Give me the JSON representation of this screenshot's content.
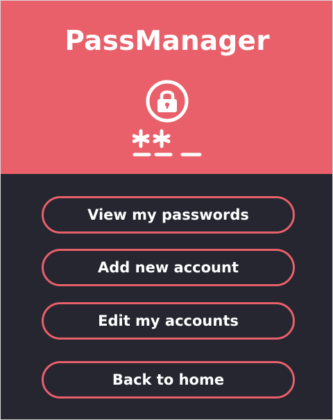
{
  "app": {
    "title": "PassManager",
    "logo_icon": "padlock-password-icon"
  },
  "menu": {
    "buttons": [
      {
        "label": "View my passwords"
      },
      {
        "label": "Add new account"
      },
      {
        "label": "Edit my accounts"
      },
      {
        "label": "Back to home"
      }
    ]
  },
  "colors": {
    "accent": "#e9606a",
    "background": "#252630",
    "text": "#ffffff"
  }
}
